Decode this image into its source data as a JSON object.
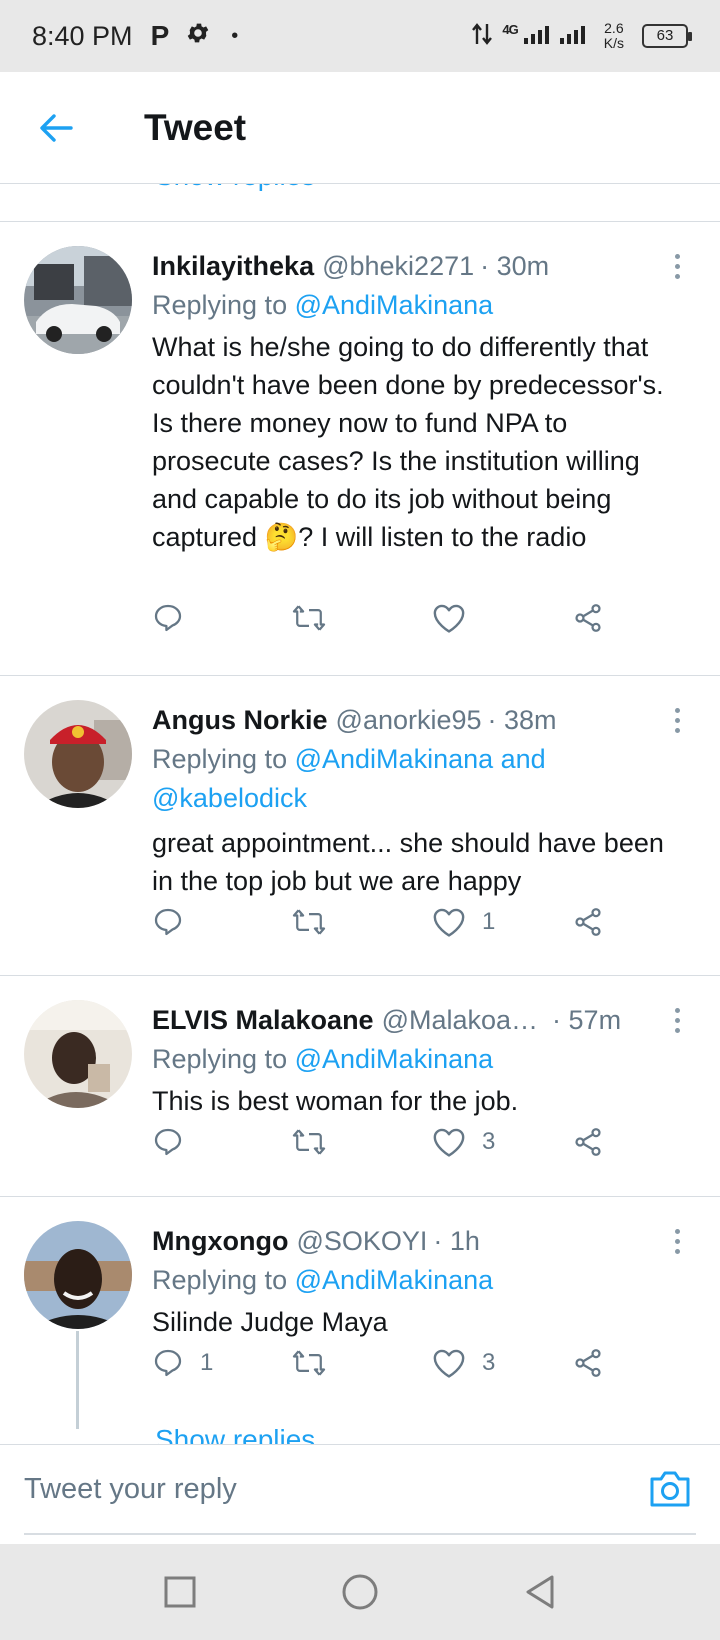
{
  "status_bar": {
    "time": "8:40 PM",
    "p_label": "P",
    "dot": "•",
    "network": "4G",
    "speed_value": "2.6",
    "speed_unit": "K/s",
    "battery": "63"
  },
  "header": {
    "title": "Tweet"
  },
  "thread_top": {
    "show_replies": "Show replies"
  },
  "tweets": [
    {
      "name": "Inkilayitheka",
      "handle": "@bheki2271",
      "time": "· 30m",
      "replying_prefix": "Replying to",
      "replying_to": "@AndiMakinana",
      "body": "What is he/she going to do differently that couldn't have been done by predecessor's. Is there money now to fund NPA to prosecute cases? Is the institution willing and capable to do its job without being captured 🤔? I will listen to the radio",
      "replies": "",
      "retweets": "",
      "likes": ""
    },
    {
      "name": "Angus Norkie",
      "handle": "@anorkie95",
      "time": "· 38m",
      "replying_prefix": "Replying to",
      "replying_to": "@AndiMakinana and @kabelodick",
      "body": "great appointment... she should have been in the top job but we are happy",
      "replies": "",
      "retweets": "",
      "likes": "1"
    },
    {
      "name": "ELVIS Malakoane",
      "handle": "@Malakoa…",
      "time": "· 57m",
      "replying_prefix": "Replying to",
      "replying_to": "@AndiMakinana",
      "body": "This is best woman for the job.",
      "replies": "",
      "retweets": "",
      "likes": "3"
    },
    {
      "name": "Mngxongo",
      "handle": "@SOKOYI",
      "time": "· 1h",
      "replying_prefix": "Replying to",
      "replying_to": "@AndiMakinana",
      "body": "Silinde Judge Maya",
      "replies": "1",
      "retweets": "",
      "likes": "3"
    }
  ],
  "thread_bottom": {
    "show_replies": "Show replies"
  },
  "reply_bar": {
    "placeholder": "Tweet your reply"
  },
  "colors": {
    "accent": "#1da1f2",
    "secondary_text": "#657786",
    "primary_text": "#14171a",
    "divider": "#d8dde2"
  }
}
